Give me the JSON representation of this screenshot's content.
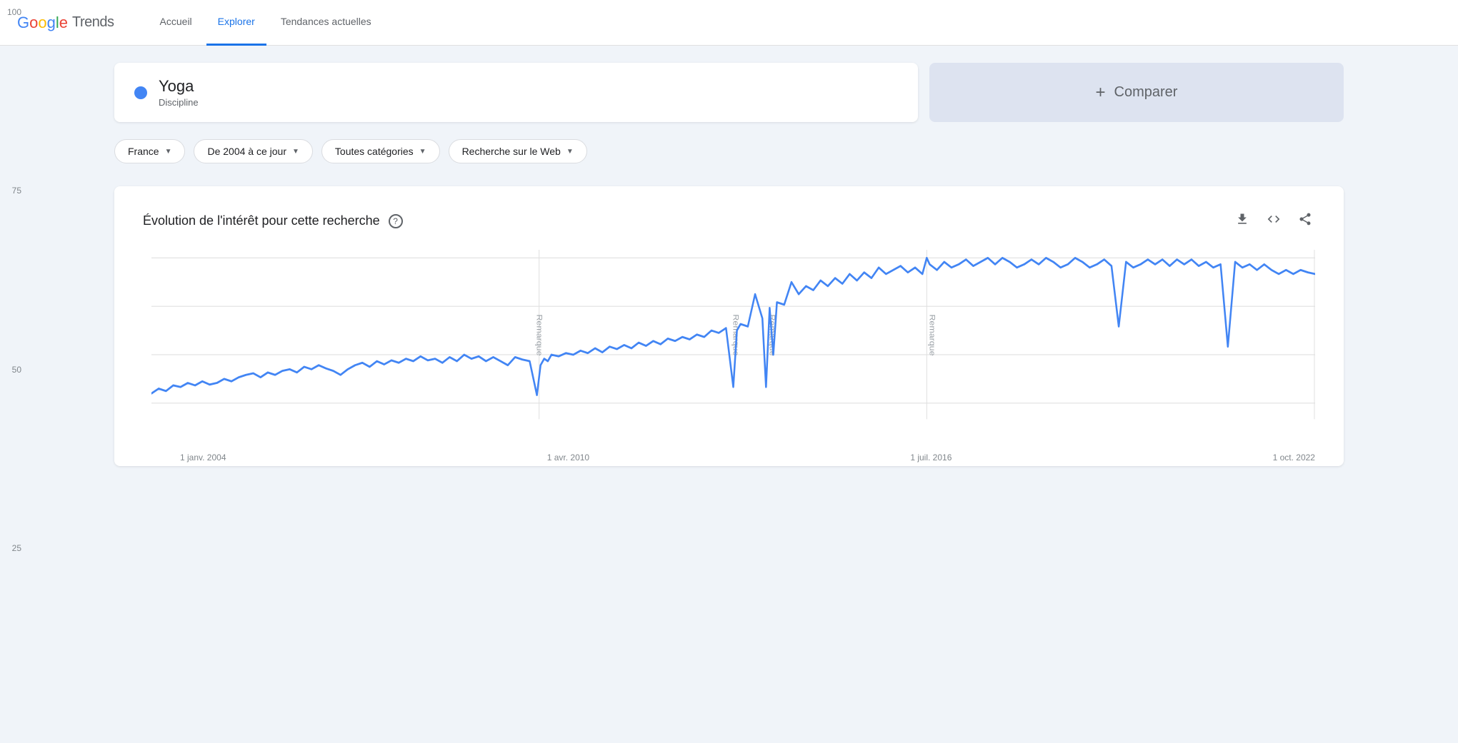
{
  "header": {
    "logo_google": "Google",
    "logo_trends": "Trends",
    "nav": [
      {
        "id": "accueil",
        "label": "Accueil",
        "active": false
      },
      {
        "id": "explorer",
        "label": "Explorer",
        "active": true
      },
      {
        "id": "tendances",
        "label": "Tendances actuelles",
        "active": false
      }
    ]
  },
  "search": {
    "term": "Yoga",
    "type": "Discipline",
    "dot_color": "#4285F4"
  },
  "compare": {
    "plus": "+",
    "label": "Comparer"
  },
  "filters": [
    {
      "id": "region",
      "label": "France"
    },
    {
      "id": "period",
      "label": "De 2004 à ce jour"
    },
    {
      "id": "category",
      "label": "Toutes catégories"
    },
    {
      "id": "type",
      "label": "Recherche sur le Web"
    }
  ],
  "chart": {
    "title": "Évolution de l'intérêt pour cette recherche",
    "help_icon": "?",
    "actions": {
      "download": "⬇",
      "embed": "<>",
      "share": "↗"
    },
    "y_labels": [
      "100",
      "75",
      "50",
      "25"
    ],
    "x_labels": [
      "1 janv. 2004",
      "1 avr. 2010",
      "1 juil. 2016",
      "1 oct. 2022"
    ],
    "remarque_labels": [
      {
        "label": "Remarque",
        "x_pct": 34
      },
      {
        "label": "Remarque",
        "x_pct": 50
      },
      {
        "label": "Remarque",
        "x_pct": 53
      },
      {
        "label": "Remarque",
        "x_pct": 67
      }
    ],
    "line_color": "#4285F4",
    "grid_color": "#e0e0e0"
  }
}
